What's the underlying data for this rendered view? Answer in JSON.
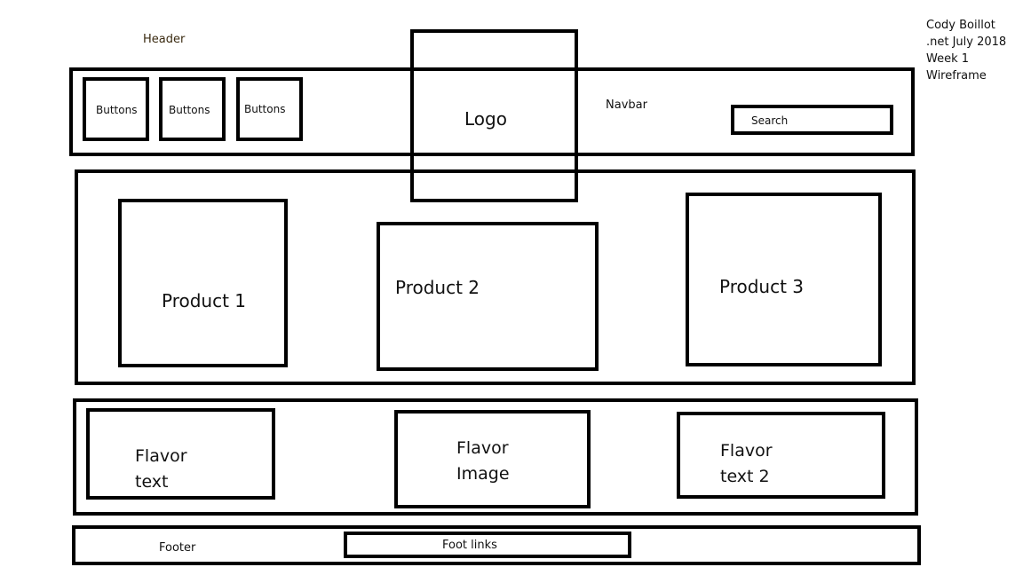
{
  "annotations": {
    "header": "Header",
    "navbar": "Navbar",
    "footer": "Footer",
    "author_note": [
      "Cody Boillot",
      ".net July 2018",
      "Week 1",
      "Wireframe"
    ]
  },
  "navbar": {
    "buttons": [
      "Buttons",
      "Buttons",
      "Buttons"
    ],
    "logo": "Logo",
    "search": "Search"
  },
  "products": [
    "Product 1",
    "Product 2",
    "Product 3"
  ],
  "flavor": {
    "text1": [
      "Flavor",
      "text"
    ],
    "image": [
      "Flavor",
      "Image"
    ],
    "text2": [
      "Flavor",
      "text 2"
    ]
  },
  "footer": {
    "links": "Foot links"
  }
}
